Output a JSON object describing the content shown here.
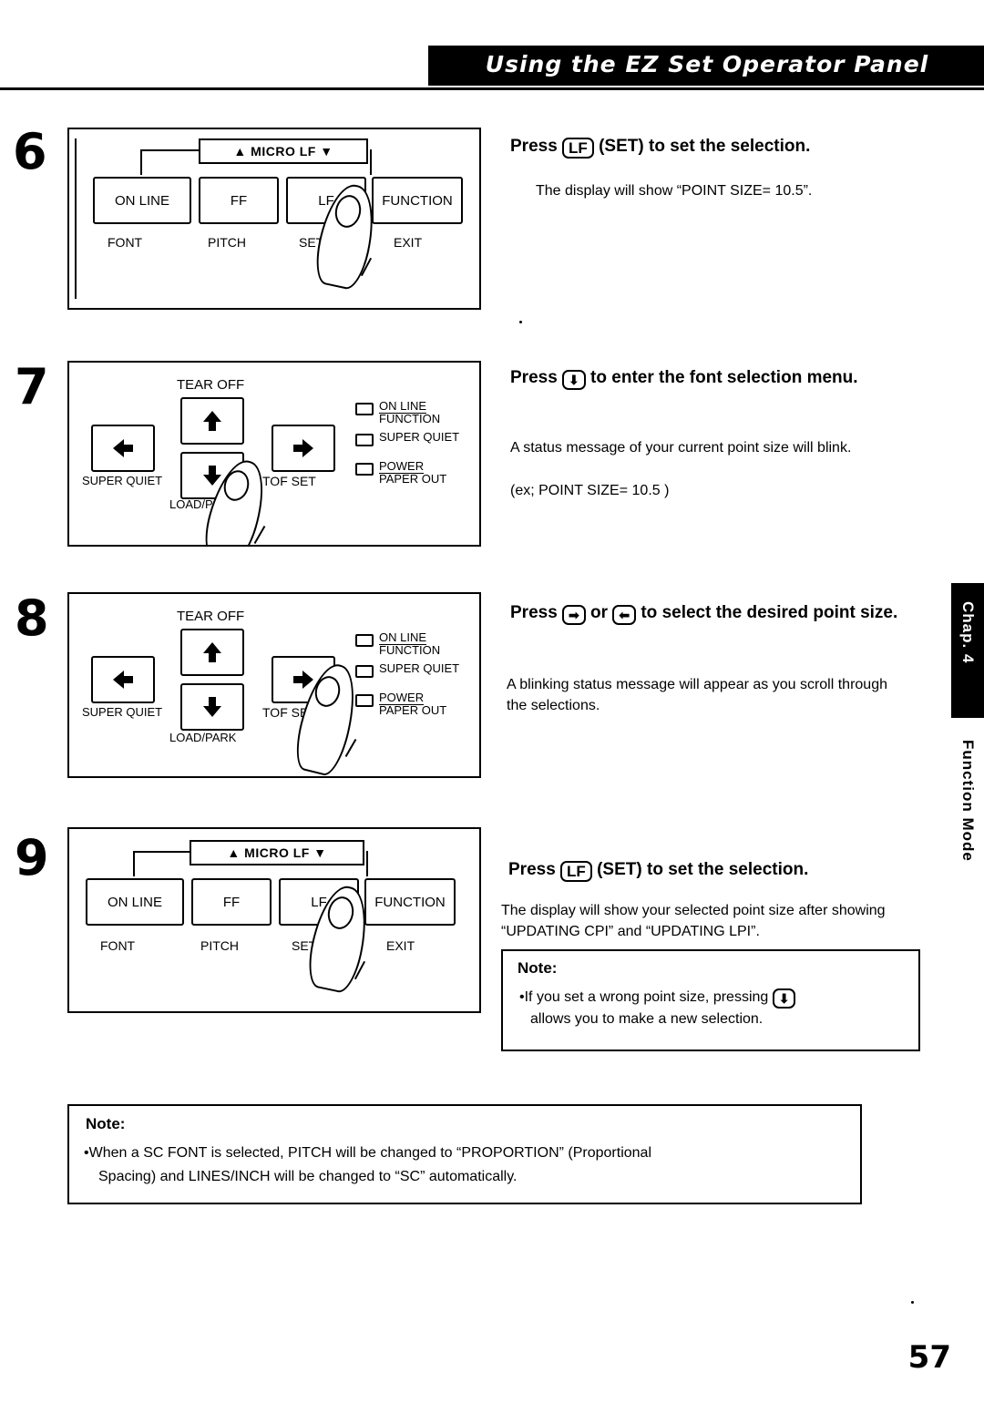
{
  "header": {
    "title": "Using the EZ Set Operator Panel"
  },
  "page_number": "57",
  "side_tab": {
    "chapter": "Chap. 4",
    "section": "Function Mode"
  },
  "steps": [
    {
      "number": "6",
      "heading_parts": {
        "pre": "Press ",
        "key": "LF",
        "post": " (SET) to set the selection."
      },
      "body": "The display will show “POINT SIZE=  10.5”.",
      "panel": {
        "type": "front-panel",
        "micro_label": "▲ MICRO LF ▼",
        "buttons": [
          "ON LINE",
          "FF",
          "LF",
          "FUNCTION"
        ],
        "sublabels": [
          "FONT",
          "PITCH",
          "SET",
          "EXIT"
        ]
      }
    },
    {
      "number": "7",
      "heading_parts": {
        "pre": "Press ",
        "key": "⬇",
        "post": " to enter the font selection menu."
      },
      "body": "A status message of your current point size will blink.",
      "body2": "(ex;  POINT SIZE=  10.5 )",
      "panel": {
        "type": "control-panel",
        "tear_off": "TEAR OFF",
        "super_quiet": "SUPER QUIET",
        "tof_set": "TOF SET",
        "load_park": "LOAD/PARK",
        "leds": [
          "ON LINE",
          "FUNCTION",
          "SUPER QUIET",
          "POWER",
          "PAPER  OUT"
        ]
      }
    },
    {
      "number": "8",
      "heading_parts": {
        "pre": "Press ",
        "key": "➡",
        "mid": " or ",
        "key2": "⬅",
        "post": " to select the desired point size."
      },
      "body": "A blinking status message will appear as you scroll through the selections.",
      "panel": {
        "type": "control-panel",
        "tear_off": "TEAR OFF",
        "super_quiet": "SUPER QUIET",
        "tof_set": "TOF SET",
        "load_park": "LOAD/PARK",
        "leds": [
          "ON LINE",
          "FUNCTION",
          "SUPER QUIET",
          "POWER",
          "PAPER  OUT"
        ]
      }
    },
    {
      "number": "9",
      "heading_parts": {
        "pre": "Press ",
        "key": "LF",
        "post": " (SET) to set the selection."
      },
      "body": "The display will show your selected point size after showing “UPDATING CPI” and “UPDATING LPI”.",
      "panel": {
        "type": "front-panel",
        "micro_label": "▲ MICRO LF ▼",
        "buttons": [
          "ON LINE",
          "FF",
          "LF",
          "FUNCTION"
        ],
        "sublabels": [
          "FONT",
          "PITCH",
          "SET",
          "EXIT"
        ]
      }
    }
  ],
  "note_right": {
    "title": "Note:",
    "bullet_pre": "•If you set a wrong point size, pressing ",
    "key": "⬇",
    "bullet_post": "allows you to make a new selection."
  },
  "note_bottom": {
    "title": "Note:",
    "line1": "•When a SC FONT is selected, PITCH will be changed to “PROPORTION” (Proportional",
    "line2": "Spacing) and LINES/INCH will be changed to “SC” automatically."
  }
}
